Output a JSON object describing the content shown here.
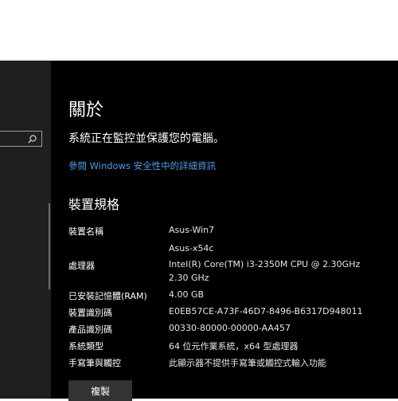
{
  "about": {
    "title": "關於",
    "protection_status": "系統正在監控並保護您的電腦。",
    "details_link": "參閱 Windows 安全性中的詳細資訊"
  },
  "specs": {
    "section_title": "裝置規格",
    "rows": [
      {
        "label": "裝置名稱",
        "value": "Asus-Win7"
      },
      {
        "label": "",
        "value": "Asus-x54c"
      },
      {
        "label": "處理器",
        "value": "Intel(R) Core(TM) i3-2350M CPU @ 2.30GHz"
      },
      {
        "label": "",
        "value": "2.30 GHz"
      },
      {
        "label": "已安裝記憶體(RAM)",
        "value": "4.00 GB"
      },
      {
        "label": "裝置識別碼",
        "value": "E0EB57CE-A73F-46D7-8496-B6317D948011"
      },
      {
        "label": "產品識別碼",
        "value": "00330-80000-00000-AA457"
      },
      {
        "label": "系統類型",
        "value": "64 位元作業系統，x64 型處理器"
      },
      {
        "label": "手寫筆與觸控",
        "value": "此顯示器不提供手寫筆或觸控式輸入功能"
      }
    ],
    "copy_button": "複製"
  },
  "sidebar": {
    "search_icon": "search-icon"
  }
}
